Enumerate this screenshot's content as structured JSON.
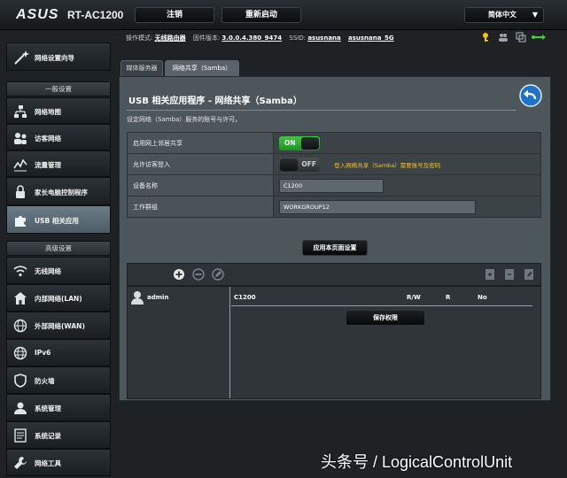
{
  "header": {
    "brand": "ASUS",
    "model": "RT-AC1200",
    "logout_label": "注销",
    "reboot_label": "重新启动",
    "language_label": "简体中文"
  },
  "info": {
    "mode_label": "操作模式:",
    "mode_value": "无线路由器",
    "firmware_label": "固件版本:",
    "firmware_value": "3.0.0.4.380_9474",
    "ssid_label": "SSID:",
    "ssid_1": "asusnana",
    "ssid_2": "asusnana_5G"
  },
  "sidebar": {
    "wizard": "网络设置向导",
    "general_header": "一般设置",
    "general_items": [
      {
        "label": "网络地图",
        "icon": "network-map-icon"
      },
      {
        "label": "访客网络",
        "icon": "guest-network-icon"
      },
      {
        "label": "流量管理",
        "icon": "traffic-manager-icon"
      },
      {
        "label": "家长电脑控制程序",
        "icon": "parental-control-icon"
      },
      {
        "label": "USB 相关应用",
        "icon": "usb-puzzle-icon"
      }
    ],
    "advanced_header": "高级设置",
    "advanced_items": [
      {
        "label": "无线网络",
        "icon": "wireless-icon"
      },
      {
        "label": "内部网络(LAN)",
        "icon": "lan-home-icon"
      },
      {
        "label": "外部网络(WAN)",
        "icon": "wan-globe-icon"
      },
      {
        "label": "IPv6",
        "icon": "ipv6-globe-icon"
      },
      {
        "label": "防火墙",
        "icon": "firewall-shield-icon"
      },
      {
        "label": "系统管理",
        "icon": "administration-icon"
      },
      {
        "label": "系统记录",
        "icon": "system-log-icon"
      },
      {
        "label": "网络工具",
        "icon": "network-tools-icon"
      }
    ]
  },
  "tabs": {
    "media": "媒体服务器",
    "samba": "网络共享（Samba）"
  },
  "panel": {
    "title": "USB 相关应用程序 - 网络共享（Samba）",
    "description": "设定网络（Samba）服务的账号与许可。",
    "rows": {
      "enable_label": "启用网上邻居共享",
      "enable_state": "ON",
      "guest_label": "允许访客登入",
      "guest_state": "OFF",
      "guest_hint": "登入网络共享（Samba）需要账号及密码",
      "device_label": "设备名称",
      "device_value": "C1200",
      "workgroup_label": "工作群组",
      "workgroup_value": "WORKGROUP12"
    },
    "apply_label": "应用本页面设置",
    "share": {
      "user": "admin",
      "folder": "C1200",
      "perm_rw": "R/W",
      "perm_r": "R",
      "perm_no": "No",
      "save_label": "保存权限"
    }
  },
  "watermark": "头条号 / LogicalControlUnit",
  "colors": {
    "toggle_on": "#26b32a",
    "hint": "#f5c12b",
    "active_nav": "#5e707b"
  }
}
